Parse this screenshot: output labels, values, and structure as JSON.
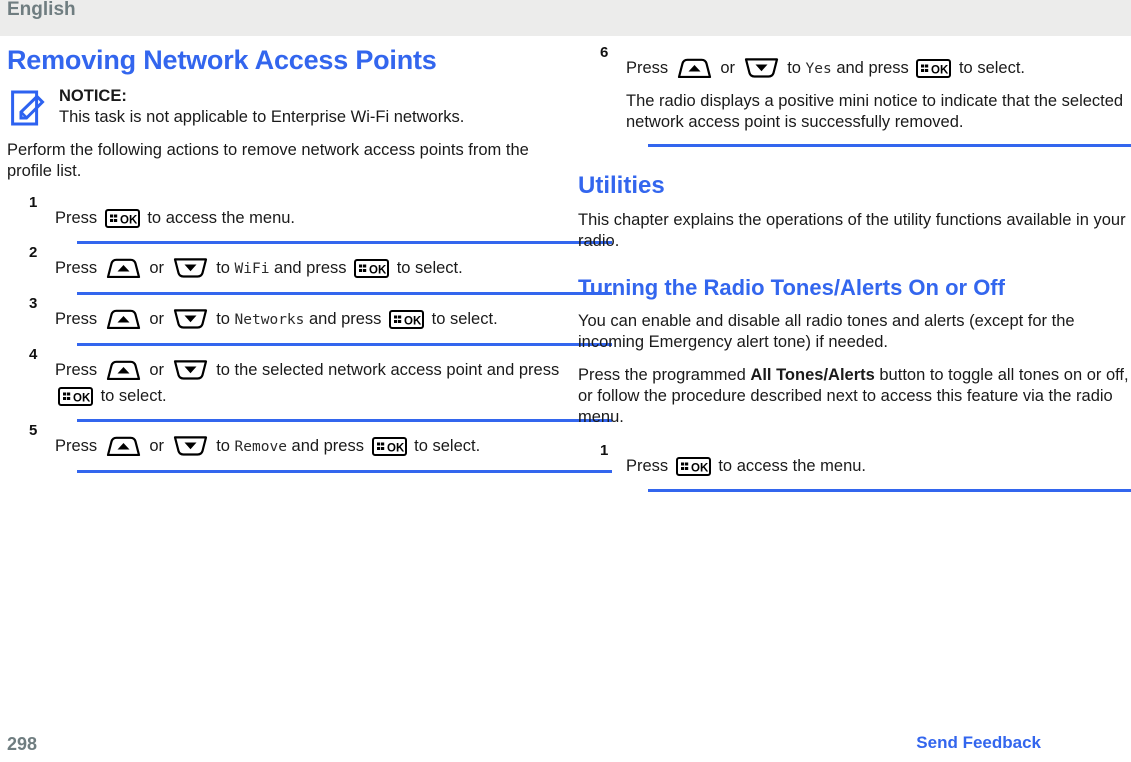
{
  "header": {
    "language": "English"
  },
  "footer": {
    "page_number": "298",
    "feedback_link": "Send Feedback",
    "page_number_color": "#6f7d80",
    "feedback_color": "#3366ee"
  },
  "theme": {
    "accent": "#3366ee",
    "header_band": "#ececeb",
    "body_text": "#1a1a1a"
  },
  "left_column": {
    "heading": "Removing Network Access Points",
    "notice": {
      "icon": "notice-pencil-icon",
      "title": "NOTICE:",
      "text": "This task is not applicable to Enterprise Wi-Fi networks."
    },
    "intro": "Perform the following actions to remove network access points from the profile list.",
    "steps": [
      {
        "num": "1",
        "parts": [
          {
            "t": "text",
            "v": "Press "
          },
          {
            "t": "key",
            "v": "ok-key"
          },
          {
            "t": "text",
            "v": " to access the menu."
          }
        ]
      },
      {
        "num": "2",
        "parts": [
          {
            "t": "text",
            "v": "Press "
          },
          {
            "t": "key",
            "v": "up-arrow-key"
          },
          {
            "t": "text",
            "v": " or "
          },
          {
            "t": "key",
            "v": "down-arrow-key"
          },
          {
            "t": "text",
            "v": " to "
          },
          {
            "t": "mono",
            "v": "WiFi"
          },
          {
            "t": "text",
            "v": " and press "
          },
          {
            "t": "key",
            "v": "ok-key"
          },
          {
            "t": "text",
            "v": " to select."
          }
        ]
      },
      {
        "num": "3",
        "parts": [
          {
            "t": "text",
            "v": "Press "
          },
          {
            "t": "key",
            "v": "up-arrow-key"
          },
          {
            "t": "text",
            "v": " or "
          },
          {
            "t": "key",
            "v": "down-arrow-key"
          },
          {
            "t": "text",
            "v": " to "
          },
          {
            "t": "mono",
            "v": "Networks"
          },
          {
            "t": "text",
            "v": " and press "
          },
          {
            "t": "key",
            "v": "ok-key"
          },
          {
            "t": "text",
            "v": " to select."
          }
        ]
      },
      {
        "num": "4",
        "parts": [
          {
            "t": "text",
            "v": "Press "
          },
          {
            "t": "key",
            "v": "up-arrow-key"
          },
          {
            "t": "text",
            "v": " or "
          },
          {
            "t": "key",
            "v": "down-arrow-key"
          },
          {
            "t": "text",
            "v": " to the selected network access point and press "
          },
          {
            "t": "key",
            "v": "ok-key"
          },
          {
            "t": "text",
            "v": " to select."
          }
        ]
      },
      {
        "num": "5",
        "parts": [
          {
            "t": "text",
            "v": "Press "
          },
          {
            "t": "key",
            "v": "up-arrow-key"
          },
          {
            "t": "text",
            "v": " or "
          },
          {
            "t": "key",
            "v": "down-arrow-key"
          },
          {
            "t": "text",
            "v": " to "
          },
          {
            "t": "mono",
            "v": "Remove"
          },
          {
            "t": "text",
            "v": " and press "
          },
          {
            "t": "key",
            "v": "ok-key"
          },
          {
            "t": "text",
            "v": " to select."
          }
        ]
      }
    ]
  },
  "right_column": {
    "step6": {
      "num": "6",
      "parts": [
        {
          "t": "text",
          "v": "Press "
        },
        {
          "t": "key",
          "v": "up-arrow-key"
        },
        {
          "t": "text",
          "v": " or "
        },
        {
          "t": "key",
          "v": "down-arrow-key"
        },
        {
          "t": "text",
          "v": " to "
        },
        {
          "t": "mono",
          "v": "Yes"
        },
        {
          "t": "text",
          "v": " and press "
        },
        {
          "t": "key",
          "v": "ok-key"
        },
        {
          "t": "text",
          "v": " to select."
        }
      ],
      "note": "The radio displays a positive mini notice to indicate that the selected network access point is successfully removed."
    },
    "utilities_heading": "Utilities",
    "utilities_intro": "This chapter explains the operations of the utility functions available in your radio.",
    "tones_heading": "Turning the Radio Tones/Alerts On or Off",
    "tones_para_1": "You can enable and disable all radio tones and alerts (except for the incoming Emergency alert tone) if needed.",
    "tones_para_2": {
      "before": "Press the programmed ",
      "bold": "All Tones/Alerts",
      "after": " button to toggle all tones on or off, or follow the procedure described next to access this feature via the radio menu."
    },
    "steps": [
      {
        "num": "1",
        "parts": [
          {
            "t": "text",
            "v": "Press "
          },
          {
            "t": "key",
            "v": "ok-key"
          },
          {
            "t": "text",
            "v": " to access the menu."
          }
        ]
      }
    ]
  }
}
